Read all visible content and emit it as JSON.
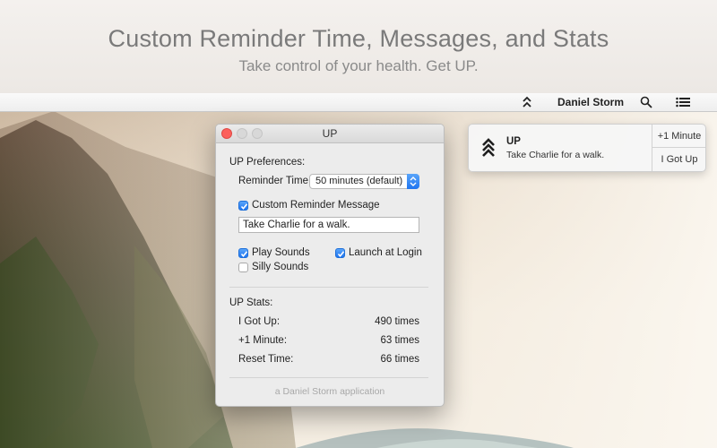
{
  "promo": {
    "title": "Custom Reminder Time, Messages, and Stats",
    "subtitle": "Take control of your health. Get UP."
  },
  "menubar": {
    "user_name": "Daniel Storm",
    "icons": [
      "up-chevrons-icon",
      "search-icon",
      "list-icon"
    ]
  },
  "window": {
    "title": "UP",
    "preferences_heading": "UP Preferences:",
    "reminder_time_label": "Reminder Time:",
    "reminder_time_value": "50 minutes (default)",
    "custom_message_label": "Custom Reminder Message",
    "custom_message_checked": true,
    "custom_message_value": "Take Charlie for a walk.",
    "play_sounds_label": "Play Sounds",
    "play_sounds_checked": true,
    "launch_at_login_label": "Launch at Login",
    "launch_at_login_checked": true,
    "silly_sounds_label": "Silly Sounds",
    "silly_sounds_checked": false,
    "stats_heading": "UP Stats:",
    "stats": [
      {
        "label": "I Got Up:",
        "value": "490 times"
      },
      {
        "label": "+1 Minute:",
        "value": "63 times"
      },
      {
        "label": "Reset Time:",
        "value": "66 times"
      }
    ],
    "footer": "a Daniel Storm application"
  },
  "notification": {
    "title": "UP",
    "body": "Take Charlie for a walk.",
    "action_primary": "+1 Minute",
    "action_secondary": "I Got Up"
  },
  "colors": {
    "accent_blue": "#1f75f0",
    "close_red": "#fc605c"
  }
}
